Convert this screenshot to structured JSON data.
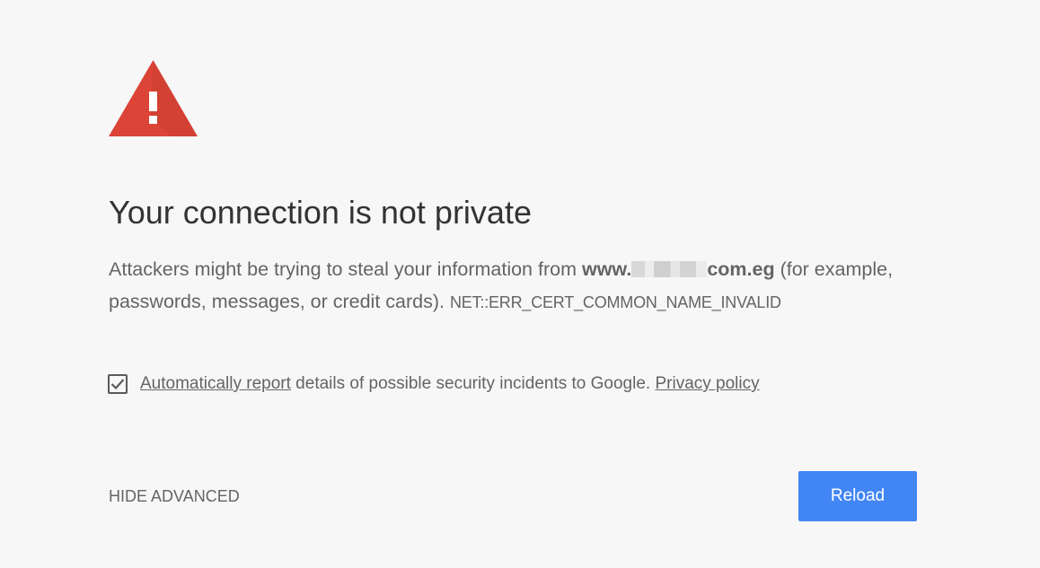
{
  "interstitial": {
    "icon": "warning-triangle-icon",
    "icon_color": "#db4437",
    "title": "Your connection is not private",
    "explanation": {
      "prefix": "Attackers might be trying to steal your information from ",
      "domain_start": "www.",
      "domain_end": "com.eg",
      "suffix": " (for example, passwords, messages, or credit cards).",
      "error_code": "NET::ERR_CERT_COMMON_NAME_INVALID"
    },
    "report": {
      "checked": true,
      "link_label": "Automatically report",
      "text": " details of possible security incidents to Google. ",
      "privacy_label": "Privacy policy"
    },
    "buttons": {
      "advanced_label": "HIDE ADVANCED",
      "reload_label": "Reload",
      "reload_color": "#4285f4"
    }
  }
}
